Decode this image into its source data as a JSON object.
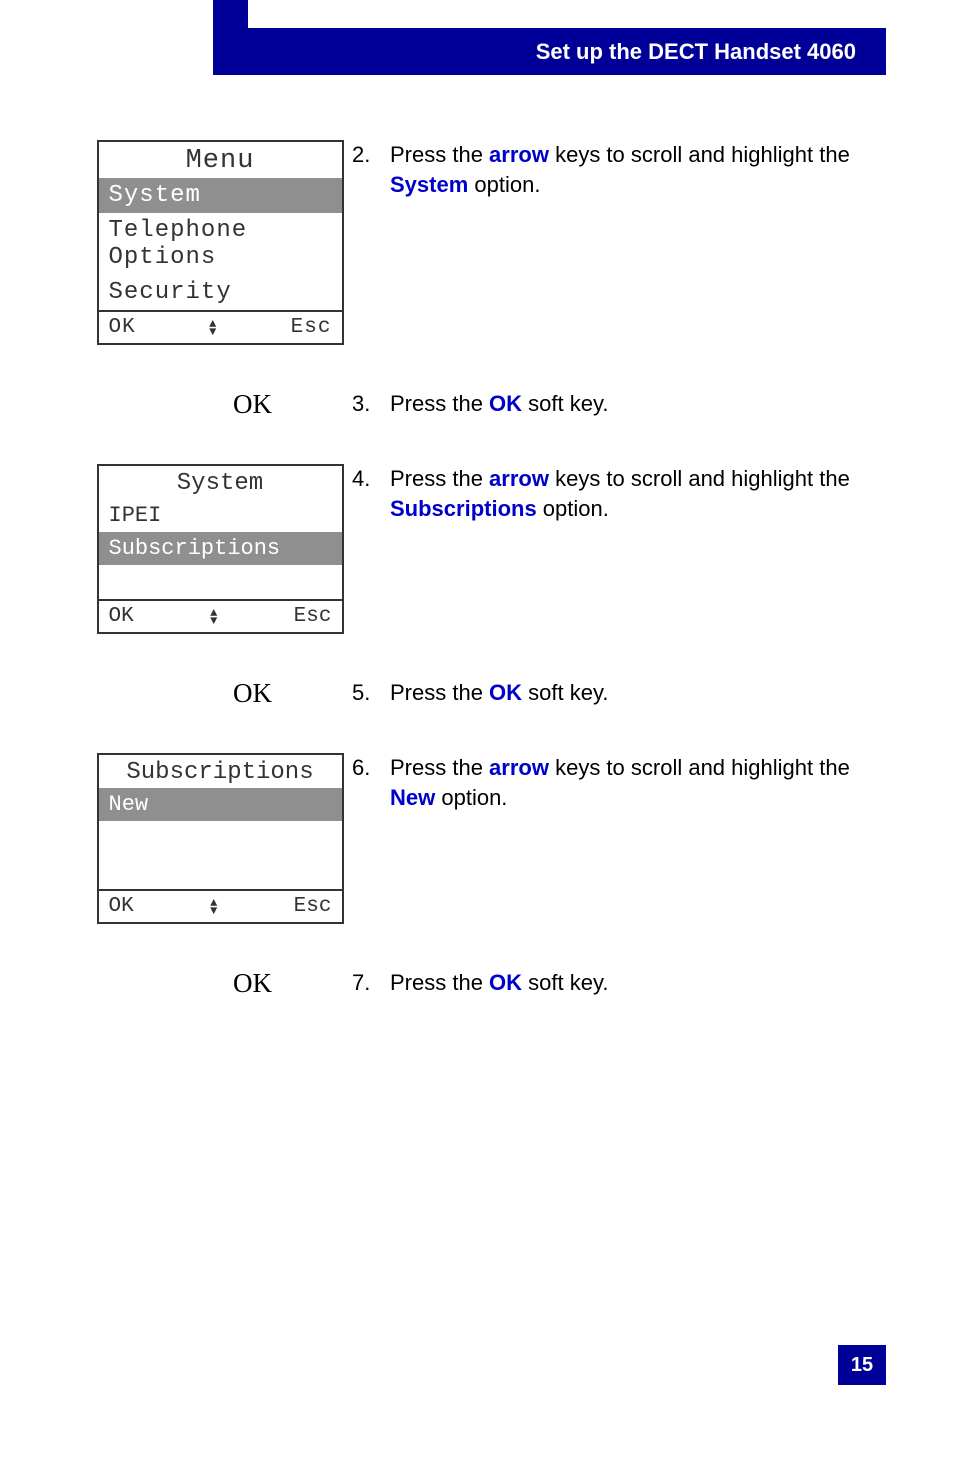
{
  "header": {
    "title": "Set up the DECT Handset 4060"
  },
  "page_number": "15",
  "softkeys": {
    "ok": "OK",
    "esc": "Esc"
  },
  "ok_label": "OK",
  "screens": {
    "menu": {
      "title": "Menu",
      "items": [
        "System",
        "Telephone Options",
        "Security"
      ],
      "selected_index": 0
    },
    "system": {
      "title": "System",
      "items": [
        "IPEI",
        "Subscriptions"
      ],
      "selected_index": 1
    },
    "subs": {
      "title": "Subscriptions",
      "items": [
        "New"
      ],
      "selected_index": 0
    }
  },
  "steps": {
    "s2": {
      "num": "2.",
      "pre": "Press the ",
      "kw1": "arrow",
      "mid": " keys to scroll and highlight the ",
      "kw2": "System",
      "post": " option."
    },
    "s3": {
      "num": "3.",
      "pre": "Press the ",
      "kw1": "OK",
      "post": " soft key."
    },
    "s4": {
      "num": "4.",
      "pre": "Press the ",
      "kw1": "arrow",
      "mid": " keys to scroll and highlight the ",
      "kw2": "Subscriptions",
      "post": " option."
    },
    "s5": {
      "num": "5.",
      "pre": "Press the ",
      "kw1": "OK",
      "post": " soft key."
    },
    "s6": {
      "num": "6.",
      "pre": "Press the ",
      "kw1": "arrow",
      "mid": " keys to scroll and highlight the ",
      "kw2": "New",
      "post": " option."
    },
    "s7": {
      "num": "7.",
      "pre": "Press the ",
      "kw1": "OK",
      "post": " soft key."
    }
  }
}
